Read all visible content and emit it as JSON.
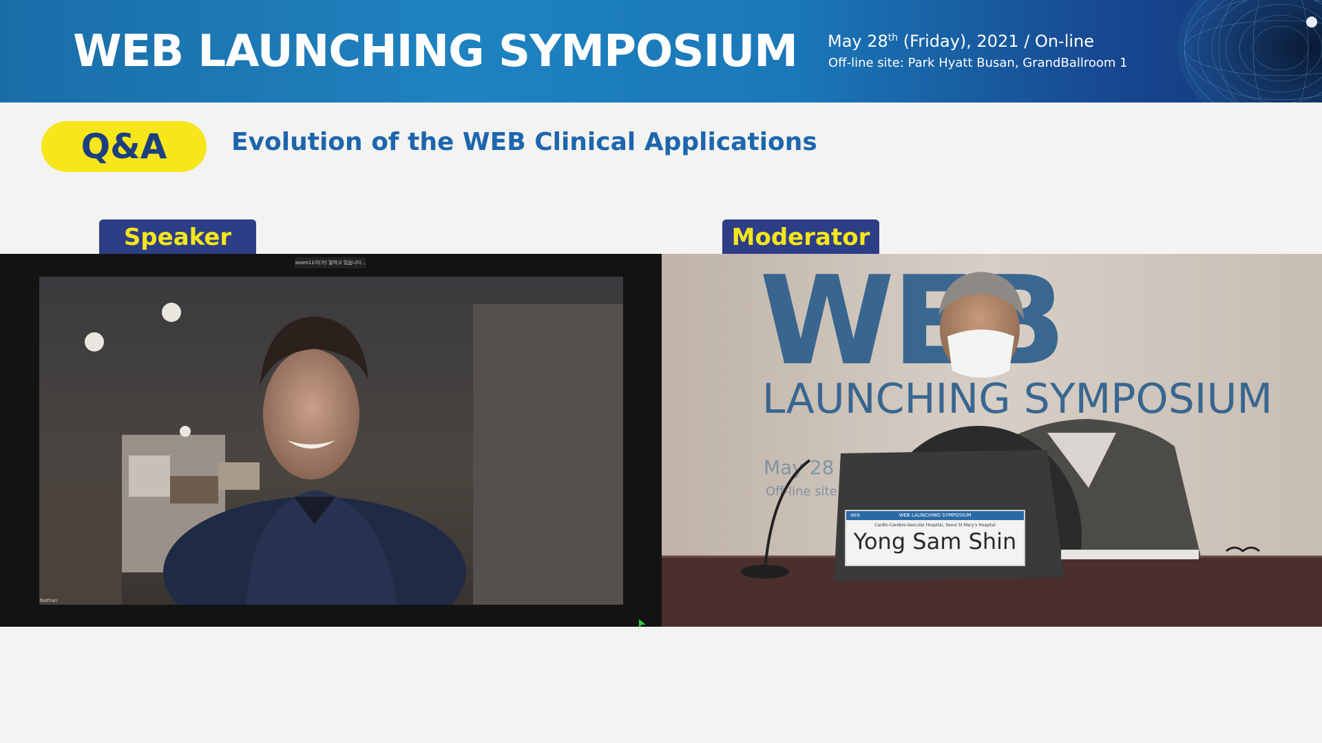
{
  "banner": {
    "title": "WEB LAUNCHING SYMPOSIUM",
    "date_prefix": "May 28",
    "date_sup": "th",
    "date_suffix": " (Friday), 2021 / On-line",
    "site": "Off-line site: Park Hyatt Busan, GrandBallroom 1"
  },
  "session": {
    "badge": "Q&A",
    "title": "Evolution of the WEB Clinical Applications"
  },
  "roles": {
    "speaker": "Speaker",
    "moderator": "Moderator"
  },
  "speaker_panel": {
    "zoom_notice": "zoom11이(가) 말하고 있습니다...",
    "name_tag": "Nathan"
  },
  "moderator_panel": {
    "backdrop_title": "WEB",
    "backdrop_subtitle": "LAUNCHING SYMPOSIUM",
    "backdrop_date": "May 28",
    "backdrop_site": "Off-line site",
    "name_card": {
      "logo": "WEB",
      "header": "WEB LAUNCHING SYMPOSIUM",
      "affiliation": "Cardio-Cerebro-Vascular Hospital, Seoul St Mary's Hospital",
      "name": "Yong Sam Shin"
    }
  },
  "colors": {
    "banner_blue": "#1f82c0",
    "badge_yellow": "#f6e61a",
    "tab_navy": "#2d3e86",
    "title_blue": "#1d66ad"
  }
}
